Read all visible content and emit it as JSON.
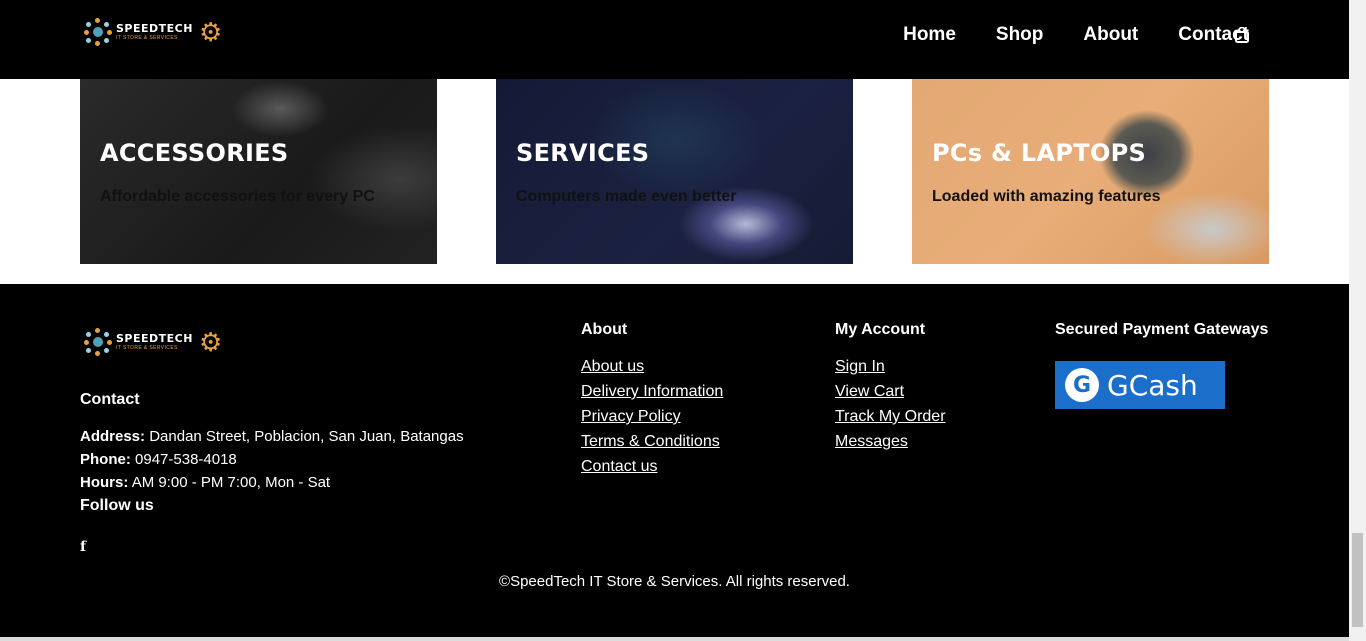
{
  "nav": {
    "logo": {
      "brand": "SPEEDTECH",
      "tagline": "IT STORE & SERVICES"
    },
    "links": [
      "Home",
      "Shop",
      "About",
      "Contact"
    ],
    "cart_icon": "shopping-bag-icon"
  },
  "categories": [
    {
      "title": "ACCESSORIES",
      "subtitle": "Affordable accessories for every PC"
    },
    {
      "title": "SERVICES",
      "subtitle": "Computers made even better"
    },
    {
      "title": "PCs & LAPTOPS",
      "subtitle": "Loaded with amazing features"
    }
  ],
  "footer": {
    "logo": {
      "brand": "SPEEDTECH",
      "tagline": "IT STORE & SERVICES"
    },
    "contact": {
      "heading": "Contact",
      "address_label": "Address:",
      "address": "Dandan Street, Poblacion, San Juan, Batangas",
      "phone_label": "Phone:",
      "phone": "0947-538-4018",
      "hours_label": "Hours:",
      "hours": "AM 9:00 - PM 7:00, Mon - Sat",
      "follow": "Follow us",
      "social_icon": "facebook-icon"
    },
    "about": {
      "heading": "About",
      "links": [
        "About us",
        "Delivery Information",
        "Privacy Policy",
        "Terms & Conditions",
        "Contact us"
      ]
    },
    "account": {
      "heading": "My Account",
      "links": [
        "Sign In",
        "View Cart",
        "Track My Order",
        "Messages"
      ]
    },
    "payment": {
      "heading": "Secured Payment Gateways",
      "gateway": "GCash"
    },
    "copyright": "©SpeedTech IT Store & Services. All rights reserved."
  },
  "colors": {
    "accent": "#e9a23b",
    "gcash_blue": "#1b6fcb",
    "background": "#000000"
  }
}
